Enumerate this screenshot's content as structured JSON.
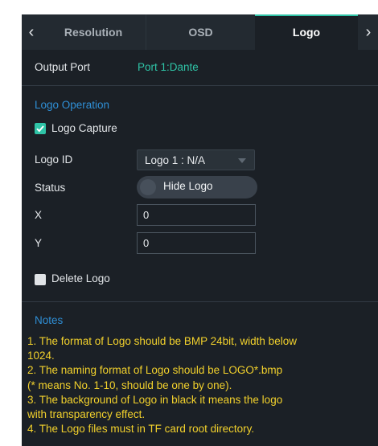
{
  "tabs": {
    "left_arrow": "‹",
    "right_arrow": "›",
    "items": [
      "Resolution",
      "OSD",
      "Logo"
    ],
    "active": "Logo"
  },
  "output_port": {
    "label": "Output Port",
    "value": "Port 1:Dante"
  },
  "logo_operation": {
    "title": "Logo Operation",
    "capture_label": "Logo Capture",
    "capture_checked": true,
    "logo_id_label": "Logo ID",
    "logo_id_value": "Logo 1 : N/A",
    "status_label": "Status",
    "status_value": "Hide Logo",
    "x_label": "X",
    "x_value": "0",
    "y_label": "Y",
    "y_value": "0",
    "delete_label": "Delete Logo",
    "delete_checked": false
  },
  "notes": {
    "title": "Notes",
    "lines": [
      "1. The format of Logo should be BMP 24bit, width below",
      "1024.",
      "2. The naming format of Logo should be LOGO*.bmp",
      "(* means No. 1-10,  should be one by one).",
      "3. The background of Logo in black it means the logo",
      "with transparency effect.",
      "4. The Logo files must in TF card root directory."
    ]
  },
  "colors": {
    "accent": "#2fc4a7",
    "section": "#2f8fd6",
    "notes": "#f2d12c",
    "panel": "#1b2026"
  }
}
